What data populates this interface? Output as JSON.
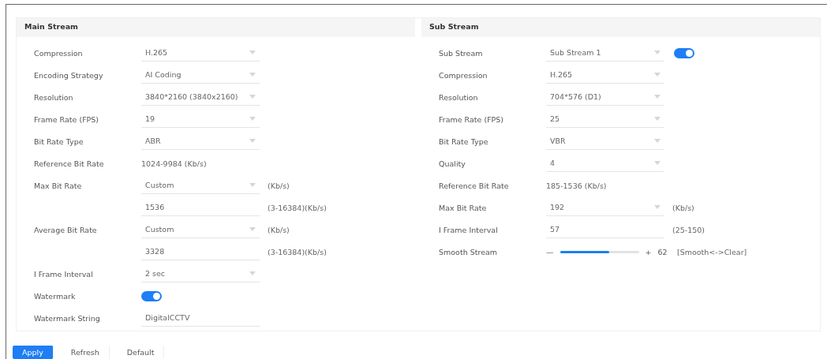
{
  "sections": [
    {
      "title": "Main Stream",
      "rows": [
        {
          "kind": "select",
          "label": "Compression",
          "value": "H.265"
        },
        {
          "kind": "select",
          "label": "Encoding Strategy",
          "value": "AI Coding"
        },
        {
          "kind": "select",
          "label": "Resolution",
          "value": "3840*2160 (3840x2160)"
        },
        {
          "kind": "select",
          "label": "Frame Rate (FPS)",
          "value": "19"
        },
        {
          "kind": "select",
          "label": "Bit Rate Type",
          "value": "ABR"
        },
        {
          "kind": "text",
          "label": "Reference Bit Rate",
          "value": "1024-9984 (Kb/s)"
        },
        {
          "kind": "select",
          "label": "Max Bit Rate",
          "value": "Custom",
          "unit": "(Kb/s)"
        },
        {
          "kind": "input",
          "value": "1536",
          "unit": "(3-16384)(Kb/s)"
        },
        {
          "kind": "select",
          "label": "Average Bit Rate",
          "value": "Custom",
          "unit": "(Kb/s)"
        },
        {
          "kind": "input",
          "value": "3328",
          "unit": "(3-16384)(Kb/s)"
        },
        {
          "kind": "select",
          "label": "I Frame Interval",
          "value": "2 sec"
        },
        {
          "kind": "toggle",
          "label": "Watermark",
          "on": true
        },
        {
          "kind": "input",
          "label": "Watermark String",
          "value": "DigitalCCTV"
        }
      ]
    },
    {
      "title": "Sub Stream",
      "rows": [
        {
          "kind": "select",
          "label": "Sub Stream",
          "value": "Sub Stream 1",
          "on": true
        },
        {
          "kind": "select",
          "label": "Compression",
          "value": "H.265"
        },
        {
          "kind": "select",
          "label": "Resolution",
          "value": "704*576 (D1)"
        },
        {
          "kind": "select",
          "label": "Frame Rate (FPS)",
          "value": "25"
        },
        {
          "kind": "select",
          "label": "Bit Rate Type",
          "value": "VBR"
        },
        {
          "kind": "select",
          "label": "Quality",
          "value": "4"
        },
        {
          "kind": "text",
          "label": "Reference Bit Rate",
          "value": "185-1536 (Kb/s)"
        },
        {
          "kind": "select",
          "label": "Max Bit Rate",
          "value": "192",
          "unit": "(Kb/s)"
        },
        {
          "kind": "input",
          "label": "I Frame Interval",
          "value": "57",
          "unit": "(25-150)"
        },
        {
          "kind": "slider",
          "label": "Smooth Stream",
          "minus": "—",
          "plus": "+",
          "level": 0.62,
          "reading": "62",
          "unit": "[Smooth<->Clear]"
        }
      ]
    }
  ],
  "buttons": [
    {
      "label": "Apply",
      "primary": true
    },
    {
      "label": "Refresh",
      "primary": false
    },
    {
      "label": "Default",
      "primary": false
    }
  ]
}
